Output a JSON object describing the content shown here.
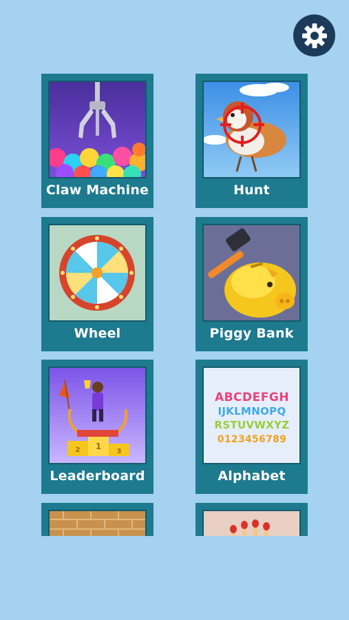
{
  "header": {
    "settings_icon": "gear-icon"
  },
  "games": [
    {
      "label": "Claw Machine",
      "thumb": "claw-machine"
    },
    {
      "label": "Hunt",
      "thumb": "bird-target"
    },
    {
      "label": "Wheel",
      "thumb": "spin-wheel"
    },
    {
      "label": "Piggy Bank",
      "thumb": "piggy-bank-hammer"
    },
    {
      "label": "Leaderboard",
      "thumb": "podium-trophy"
    },
    {
      "label": "Alphabet",
      "thumb": "colorful-letters"
    },
    {
      "label": "",
      "thumb": "brick-wall"
    },
    {
      "label": "",
      "thumb": "matches"
    }
  ],
  "alphabet_rows": [
    "ABCDEFGH",
    "IJKLMNOPQ",
    "RSTUVWXYZ",
    "0123456789"
  ],
  "podium_numbers": [
    "2",
    "1",
    "3"
  ],
  "colors": {
    "background": "#a5d2f0",
    "card": "#1d7a8f",
    "settings": "#1c3a5a"
  }
}
